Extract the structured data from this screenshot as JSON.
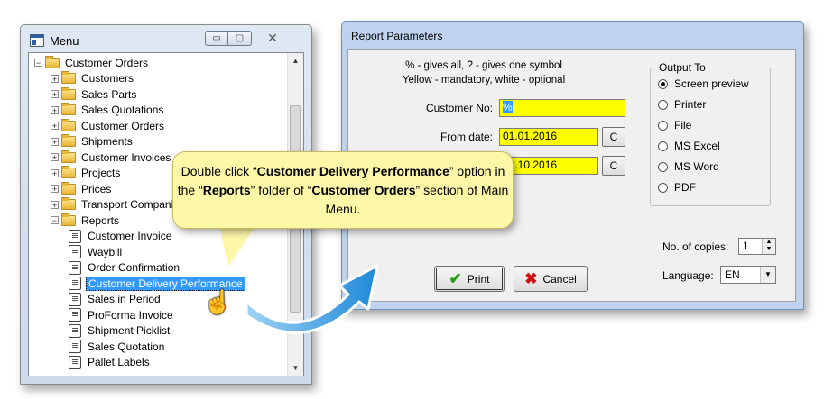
{
  "menu_window": {
    "title": "Menu",
    "controls": {
      "minimize": "▭",
      "maximize": "▢",
      "close": "✕"
    },
    "tree": [
      {
        "label": "Customer Orders",
        "level": 0,
        "type": "folder",
        "expander": "−"
      },
      {
        "label": "Customers",
        "level": 1,
        "type": "folder",
        "expander": "+"
      },
      {
        "label": "Sales Parts",
        "level": 1,
        "type": "folder",
        "expander": "+"
      },
      {
        "label": "Sales Quotations",
        "level": 1,
        "type": "folder",
        "expander": "+"
      },
      {
        "label": "Customer Orders",
        "level": 1,
        "type": "folder",
        "expander": "+"
      },
      {
        "label": "Shipments",
        "level": 1,
        "type": "folder",
        "expander": "+"
      },
      {
        "label": "Customer Invoices",
        "level": 1,
        "type": "folder",
        "expander": "+"
      },
      {
        "label": "Projects",
        "level": 1,
        "type": "folder",
        "expander": "+"
      },
      {
        "label": "Prices",
        "level": 1,
        "type": "folder",
        "expander": "+"
      },
      {
        "label": "Transport Compani",
        "level": 1,
        "type": "folder",
        "expander": "+"
      },
      {
        "label": "Reports",
        "level": 1,
        "type": "folder",
        "expander": "−"
      },
      {
        "label": "Customer Invoice",
        "level": 2,
        "type": "report"
      },
      {
        "label": "Waybill",
        "level": 2,
        "type": "report"
      },
      {
        "label": "Order Confirmation",
        "level": 2,
        "type": "report"
      },
      {
        "label": "Customer Delivery Performance",
        "level": 2,
        "type": "report",
        "selected": true
      },
      {
        "label": "Sales in Period",
        "level": 2,
        "type": "report"
      },
      {
        "label": "ProForma Invoice",
        "level": 2,
        "type": "report"
      },
      {
        "label": "Shipment Picklist",
        "level": 2,
        "type": "report"
      },
      {
        "label": "Sales Quotation",
        "level": 2,
        "type": "report"
      },
      {
        "label": "Pallet Labels",
        "level": 2,
        "type": "report"
      }
    ]
  },
  "params_window": {
    "title": "Report Parameters",
    "hint_line1": "% - gives all, ? - gives one symbol",
    "hint_line2": "Yellow - mandatory, white - optional",
    "customer_no_label": "Customer No:",
    "customer_no_value": "%",
    "from_date_label": "From date:",
    "from_date_value": "01.01.2016",
    "to_date_value": "19.10.2016",
    "c_button": "C",
    "output_to": "Output To",
    "output_options": [
      "Screen preview",
      "Printer",
      "File",
      "MS Excel",
      "MS Word",
      "PDF"
    ],
    "output_selected": "Screen preview",
    "copies_label": "No. of copies:",
    "copies_value": "1",
    "language_label": "Language:",
    "language_value": "EN",
    "print_button": "Print",
    "cancel_button": "Cancel"
  },
  "callout": {
    "part1": "Double click “",
    "bold1": "Customer Delivery Performance",
    "part2": "” option in the “",
    "bold2": "Reports",
    "part3": "” folder of “",
    "bold3": "Customer Orders",
    "part4": "” section of Main Menu."
  },
  "colors": {
    "mandatory_field": "#ffff00",
    "selection": "#3399ff",
    "callout_bg": "#fdf7a8",
    "arrow": "#3aa0e0"
  },
  "icons": {
    "folder": "folder-icon",
    "report": "report-icon",
    "print": "check-icon",
    "cancel": "x-icon",
    "cursor": "hand-pointer-icon"
  }
}
